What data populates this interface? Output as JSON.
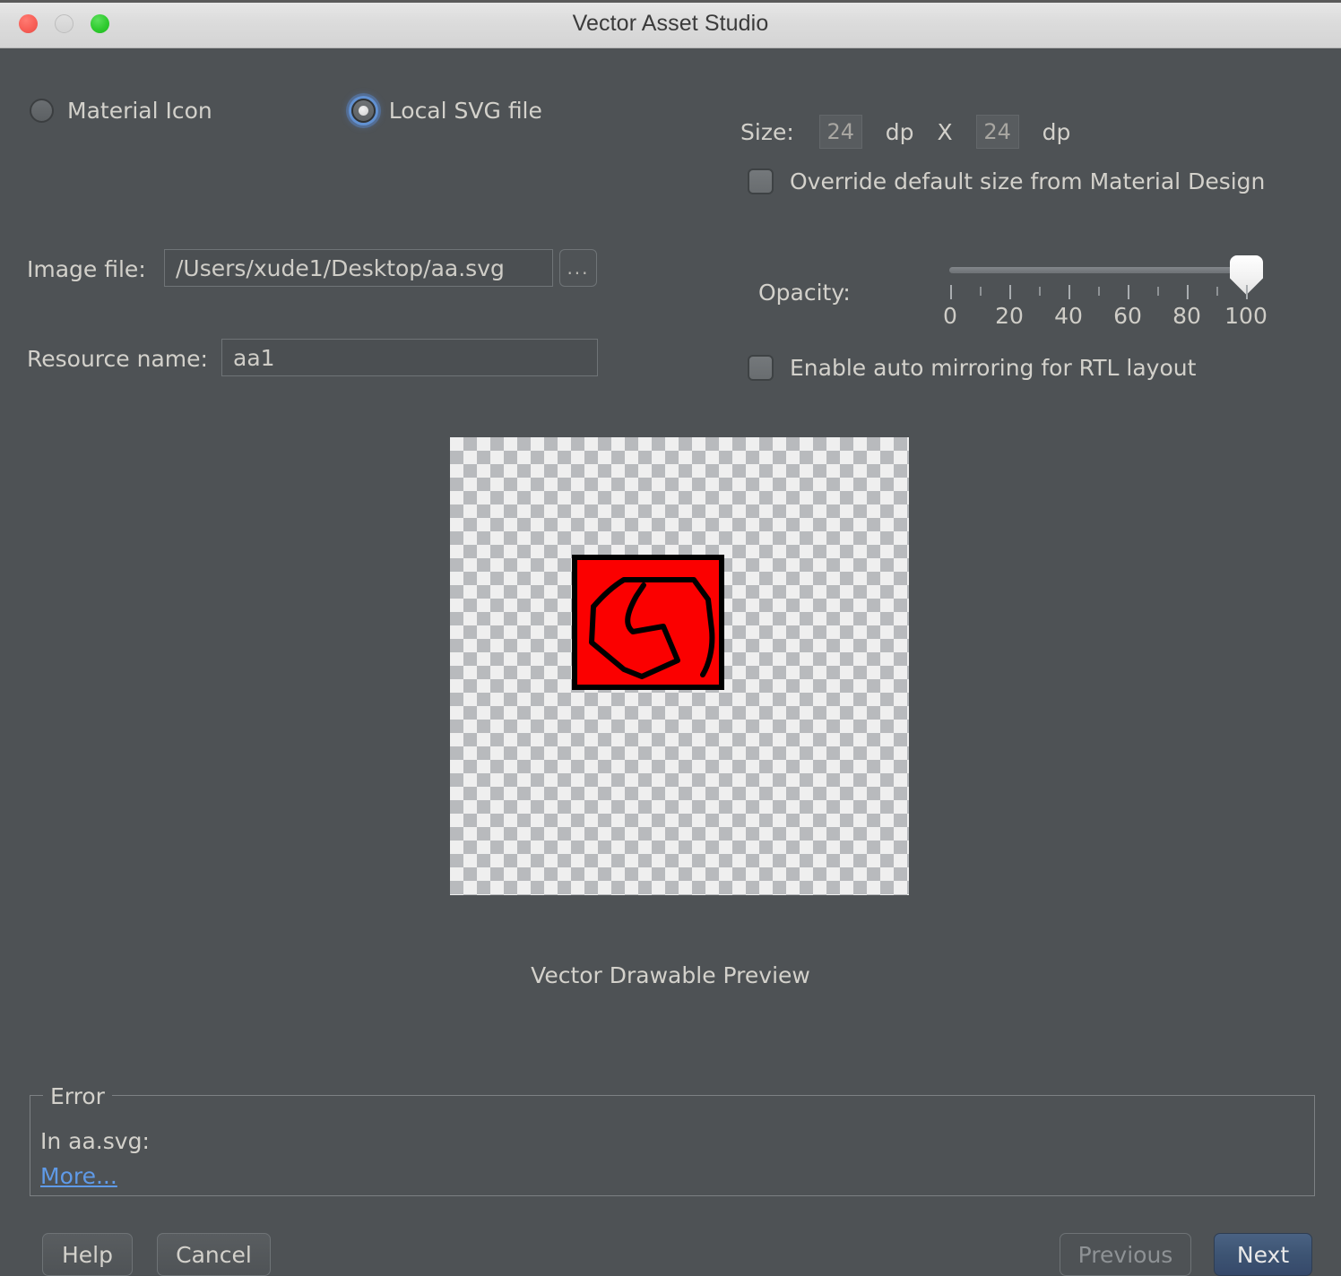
{
  "window": {
    "title": "Vector Asset Studio",
    "traffic_lights": {
      "close": "close-button",
      "minimize": "minimize-button",
      "maximize": "maximize-button"
    }
  },
  "asset_source": {
    "options": [
      {
        "label": "Material Icon",
        "selected": false
      },
      {
        "label": "Local SVG file",
        "selected": true
      }
    ]
  },
  "form": {
    "image_file_label": "Image file:",
    "image_file_value": "/Users/xude1/Desktop/aa.svg",
    "browse_label": "...",
    "resource_name_label": "Resource name:",
    "resource_name_value": "aa1"
  },
  "size": {
    "label": "Size:",
    "width_value": "24",
    "unit_1": "dp",
    "separator": "X",
    "height_value": "24",
    "unit_2": "dp",
    "override_label": "Override default size from Material Design",
    "override_checked": false
  },
  "opacity": {
    "label": "Opacity:",
    "value": 100,
    "min": 0,
    "max": 100,
    "major_ticks": [
      "0",
      "20",
      "40",
      "60",
      "80",
      "100"
    ],
    "minor_ticks": [
      10,
      30,
      50,
      70,
      90
    ]
  },
  "rtl": {
    "label": "Enable auto mirroring for RTL layout",
    "checked": false
  },
  "preview": {
    "caption": "Vector Drawable Preview",
    "icon_fill": "#fb0000",
    "icon_stroke": "#000000",
    "checker_light": "#efefef",
    "checker_dark": "#b8babd"
  },
  "error": {
    "legend": "Error",
    "message": "In aa.svg:",
    "more_link": "More..."
  },
  "buttons": {
    "help": "Help",
    "cancel": "Cancel",
    "previous": "Previous",
    "next": "Next"
  },
  "colors": {
    "window_bg": "#4e5255",
    "text": "#d3d1cb",
    "link": "#5f9ae8",
    "accent_button": "#3d5473"
  }
}
